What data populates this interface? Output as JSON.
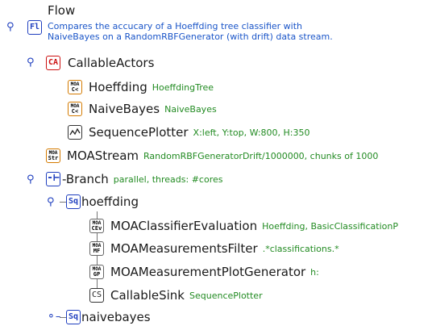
{
  "tree": {
    "flow": {
      "label": "Flow",
      "icon_text": "Fl",
      "description_line1": "Compares the accucary of a Hoeffding tree classifier with",
      "description_line2": "NaiveBayes on a RandomRBFGenerator (with drift) data stream."
    },
    "callable_actors": {
      "label": "CallableActors",
      "icon_text": "CA"
    },
    "hoeffding": {
      "label": "Hoeffding",
      "info": "HoeffdingTree",
      "icon_top": "MOA",
      "icon_bottom": "C<"
    },
    "naivebayes_actor": {
      "label": "NaiveBayes",
      "info": "NaiveBayes",
      "icon_top": "MOA",
      "icon_bottom": "C<"
    },
    "sequence_plotter": {
      "label": "SequencePlotter",
      "info": "X:left, Y:top, W:800, H:350"
    },
    "moastream": {
      "label": "MOAStream",
      "info": "RandomRBFGeneratorDrift/1000000, chunks of 1000",
      "icon_top": "MOA",
      "icon_bottom": "Str"
    },
    "branch": {
      "label": "-Branch",
      "info": "parallel, threads: #cores"
    },
    "seq_hoeffding": {
      "label": "hoeffding",
      "icon_text": "Sq"
    },
    "classifier_eval": {
      "label": "MOAClassifierEvaluation",
      "info": "Hoeffding, BasicClassificationP",
      "icon_top": "MOA",
      "icon_bottom": "CEv"
    },
    "measurements_filter": {
      "label": "MOAMeasurementsFilter",
      "info": ".*classifications.*",
      "icon_top": "MOA",
      "icon_bottom": "MF"
    },
    "plot_generator": {
      "label": "MOAMeasurementPlotGenerator",
      "info": "h:",
      "icon_top": "MOA",
      "icon_bottom": "GP"
    },
    "callable_sink": {
      "label": "CallableSink",
      "info": "SequencePlotter",
      "icon_text": "CS"
    },
    "seq_naivebayes": {
      "label": "naivebayes",
      "icon_text": "Sq"
    }
  },
  "icons": {
    "expanded": "expanded-handle-icon",
    "collapsed": "collapsed-handle-icon"
  },
  "colors": {
    "info": "#228b22",
    "description": "#1a55c8",
    "moa_border": "#d47a00",
    "flow_icon": "#1f3fbf",
    "callable_actors_icon": "#cc1111"
  }
}
